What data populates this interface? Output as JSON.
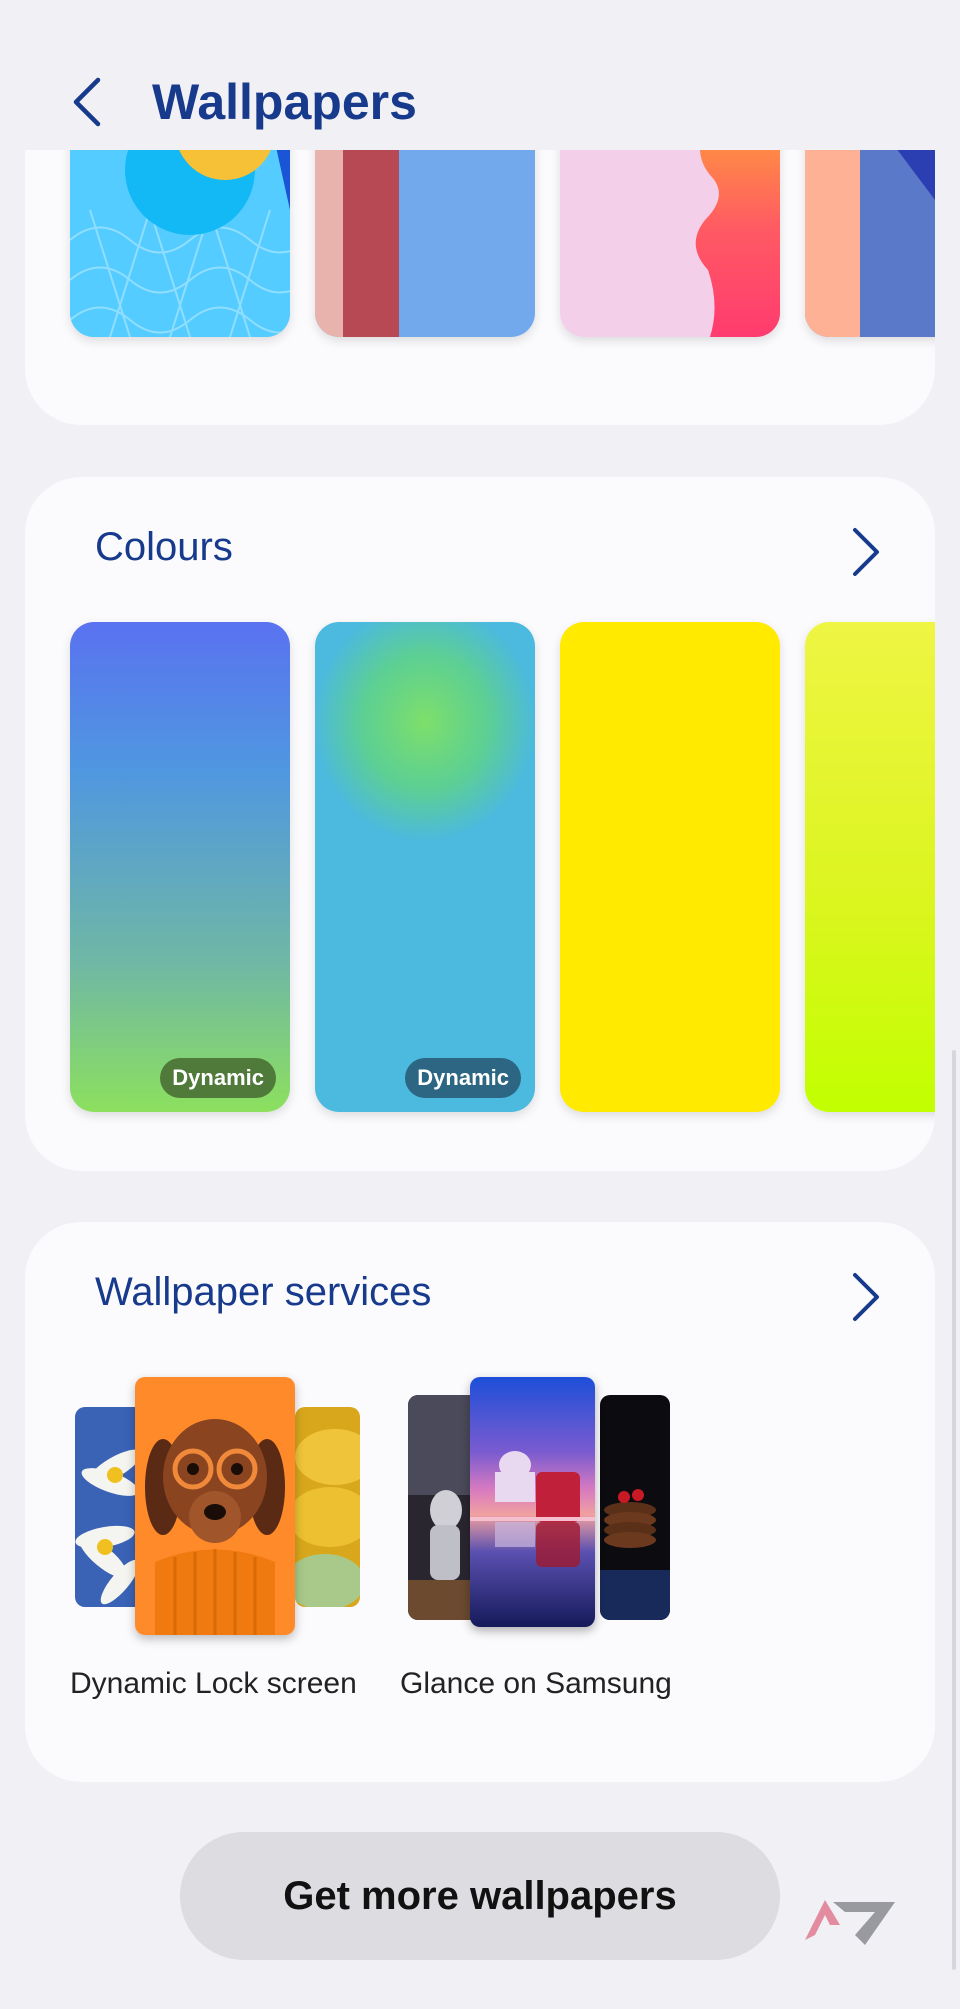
{
  "header": {
    "title": "Wallpapers"
  },
  "colours": {
    "title": "Colours",
    "items": [
      {
        "name": "blue-green-gradient",
        "badge": "Dynamic"
      },
      {
        "name": "sky-green-radial",
        "badge": "Dynamic"
      },
      {
        "name": "solid-yellow"
      },
      {
        "name": "yellow-lime-gradient"
      }
    ]
  },
  "services": {
    "title": "Wallpaper services",
    "items": [
      {
        "label": "Dynamic Lock screen"
      },
      {
        "label": "Glance on Samsung"
      }
    ]
  },
  "footer": {
    "button_label": "Get more wallpapers"
  },
  "colors": {
    "accent": "#173a8c",
    "badge_green": "#4f7a3a",
    "badge_blue": "#2c6683"
  }
}
